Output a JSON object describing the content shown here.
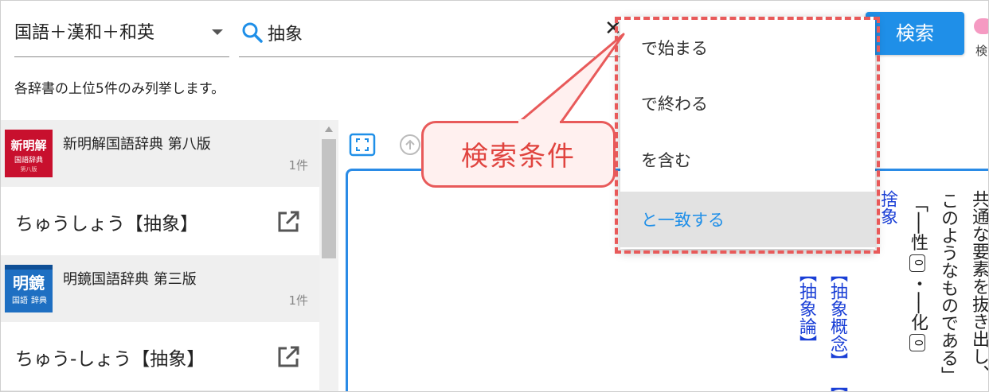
{
  "header": {
    "dictionary_select": "国語＋漢和＋和英",
    "search_value": "抽象",
    "search_button": "検索",
    "toggle_label": "検",
    "hint": "各辞書の上位5件のみ列挙します。"
  },
  "results": [
    {
      "dictionary": "新明解国語辞典 第八版",
      "count": "1件",
      "cover_lines": [
        "新明解",
        "国語辞典",
        "第八版"
      ],
      "cover_color": "#c8102e",
      "entry": "ちゅうしょう【抽象】"
    },
    {
      "dictionary": "明鏡国語辞典 第三版",
      "count": "1件",
      "cover_lines": [
        "明鏡",
        "国語",
        "辞典"
      ],
      "cover_color": "#1e6fc2",
      "entry": "ちゅう-しょう【抽象】"
    }
  ],
  "match_options": [
    {
      "label": "で始まる",
      "selected": false
    },
    {
      "label": "で終わる",
      "selected": false
    },
    {
      "label": "を含む",
      "selected": false
    },
    {
      "label": "と一致する",
      "selected": true
    }
  ],
  "callout": {
    "text": "検索条件"
  },
  "content": {
    "col1": "共通な要素を抜き出し、",
    "col2": "このようなものである」",
    "col3_a": "「──性",
    "col3_b": "・──化",
    "col3_circle": "0",
    "col4": "捨象",
    "col5_a": "【抽象概念】",
    "col5_b": "【抽",
    "col6": "【抽象論】"
  },
  "colors": {
    "accent": "#1f8fe8",
    "annotation": "#e85a5a",
    "link_blue": "#1a3fd6"
  }
}
